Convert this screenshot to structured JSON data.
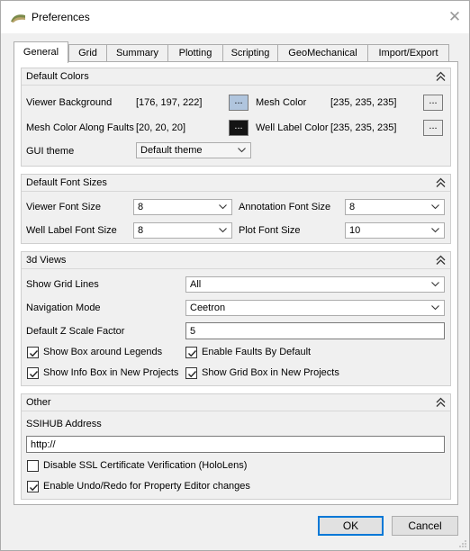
{
  "window": {
    "title": "Preferences"
  },
  "tabs": [
    "General",
    "Grid",
    "Summary",
    "Plotting",
    "Scripting",
    "GeoMechanical",
    "Import/Export"
  ],
  "default_colors": {
    "title": "Default Colors",
    "viewer_background_label": "Viewer Background",
    "viewer_background_value": "[176, 197, 222]",
    "viewer_background_color": "#b0c5de",
    "mesh_color_label": "Mesh Color",
    "mesh_color_value": "[235, 235, 235]",
    "mesh_color_color": "#ebebeb",
    "mesh_faults_label": "Mesh Color Along Faults",
    "mesh_faults_value": "[20, 20, 20]",
    "mesh_faults_color": "#141414",
    "well_label_color_label": "Well Label Color",
    "well_label_color_value": "[235, 235, 235]",
    "well_label_color_color": "#ebebeb",
    "color_button_text": "...",
    "gui_theme_label": "GUI theme",
    "gui_theme_value": "Default theme"
  },
  "default_font_sizes": {
    "title": "Default Font Sizes",
    "viewer_font_label": "Viewer Font Size",
    "viewer_font_value": "8",
    "annotation_font_label": "Annotation Font Size",
    "annotation_font_value": "8",
    "well_label_font_label": "Well Label Font Size",
    "well_label_font_value": "8",
    "plot_font_label": "Plot Font Size",
    "plot_font_value": "10"
  },
  "views_3d": {
    "title": "3d Views",
    "show_grid_lines_label": "Show Grid Lines",
    "show_grid_lines_value": "All",
    "navigation_mode_label": "Navigation Mode",
    "navigation_mode_value": "Ceetron",
    "z_scale_label": "Default Z Scale Factor",
    "z_scale_value": "5",
    "show_box_legends": {
      "label": "Show Box around Legends",
      "checked": true
    },
    "enable_faults": {
      "label": "Enable Faults By Default",
      "checked": true
    },
    "show_info_box": {
      "label": "Show Info Box in New Projects",
      "checked": true
    },
    "show_grid_box": {
      "label": "Show Grid Box in New Projects",
      "checked": true
    }
  },
  "other": {
    "title": "Other",
    "ssihub_label": "SSIHUB Address",
    "ssihub_value": "http://",
    "disable_ssl": {
      "label": "Disable SSL Certificate Verification (HoloLens)",
      "checked": false
    },
    "enable_undo": {
      "label": "Enable Undo/Redo for Property Editor changes",
      "checked": true
    }
  },
  "buttons": {
    "ok": "OK",
    "cancel": "Cancel"
  },
  "colors": {
    "accent": "#0078d7"
  }
}
